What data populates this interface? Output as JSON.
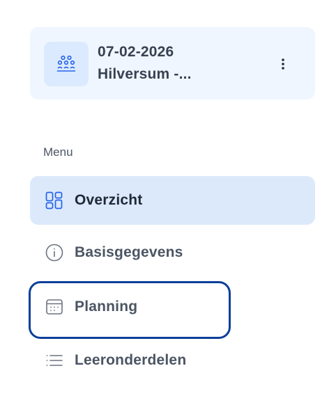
{
  "context": {
    "date": "07-02-2026",
    "location": "Hilversum -...",
    "icon": "group-icon",
    "menu_icon": "more-vertical-icon"
  },
  "menu": {
    "section_label": "Menu",
    "items": [
      {
        "label": "Overzicht",
        "icon": "layout-icon",
        "active": true
      },
      {
        "label": "Basisgegevens",
        "icon": "info-icon",
        "active": false
      },
      {
        "label": "Planning",
        "icon": "calendar-icon",
        "active": false,
        "focused": true
      },
      {
        "label": "Leeronderdelen",
        "icon": "list-icon",
        "active": false
      }
    ]
  },
  "colors": {
    "card_bg": "#eff6ff",
    "active_bg": "#dbe9fb",
    "accent": "#2563eb",
    "focus_ring": "#0b3f9a",
    "text": "#4b5563"
  }
}
